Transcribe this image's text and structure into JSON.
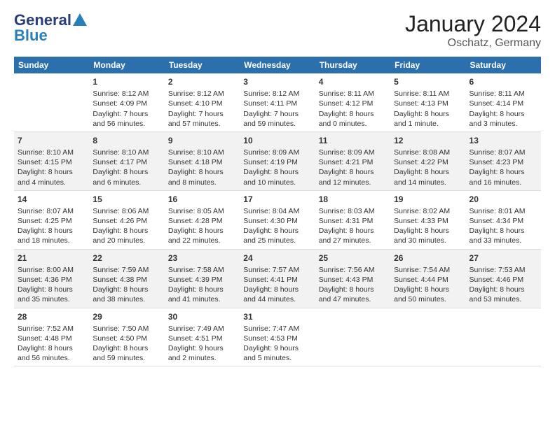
{
  "logo": {
    "general": "General",
    "blue": "Blue"
  },
  "header": {
    "title": "January 2024",
    "location": "Oschatz, Germany"
  },
  "columns": [
    "Sunday",
    "Monday",
    "Tuesday",
    "Wednesday",
    "Thursday",
    "Friday",
    "Saturday"
  ],
  "weeks": [
    [
      {
        "day": "",
        "info": ""
      },
      {
        "day": "1",
        "info": "Sunrise: 8:12 AM\nSunset: 4:09 PM\nDaylight: 7 hours\nand 56 minutes."
      },
      {
        "day": "2",
        "info": "Sunrise: 8:12 AM\nSunset: 4:10 PM\nDaylight: 7 hours\nand 57 minutes."
      },
      {
        "day": "3",
        "info": "Sunrise: 8:12 AM\nSunset: 4:11 PM\nDaylight: 7 hours\nand 59 minutes."
      },
      {
        "day": "4",
        "info": "Sunrise: 8:11 AM\nSunset: 4:12 PM\nDaylight: 8 hours\nand 0 minutes."
      },
      {
        "day": "5",
        "info": "Sunrise: 8:11 AM\nSunset: 4:13 PM\nDaylight: 8 hours\nand 1 minute."
      },
      {
        "day": "6",
        "info": "Sunrise: 8:11 AM\nSunset: 4:14 PM\nDaylight: 8 hours\nand 3 minutes."
      }
    ],
    [
      {
        "day": "7",
        "info": "Sunrise: 8:10 AM\nSunset: 4:15 PM\nDaylight: 8 hours\nand 4 minutes."
      },
      {
        "day": "8",
        "info": "Sunrise: 8:10 AM\nSunset: 4:17 PM\nDaylight: 8 hours\nand 6 minutes."
      },
      {
        "day": "9",
        "info": "Sunrise: 8:10 AM\nSunset: 4:18 PM\nDaylight: 8 hours\nand 8 minutes."
      },
      {
        "day": "10",
        "info": "Sunrise: 8:09 AM\nSunset: 4:19 PM\nDaylight: 8 hours\nand 10 minutes."
      },
      {
        "day": "11",
        "info": "Sunrise: 8:09 AM\nSunset: 4:21 PM\nDaylight: 8 hours\nand 12 minutes."
      },
      {
        "day": "12",
        "info": "Sunrise: 8:08 AM\nSunset: 4:22 PM\nDaylight: 8 hours\nand 14 minutes."
      },
      {
        "day": "13",
        "info": "Sunrise: 8:07 AM\nSunset: 4:23 PM\nDaylight: 8 hours\nand 16 minutes."
      }
    ],
    [
      {
        "day": "14",
        "info": "Sunrise: 8:07 AM\nSunset: 4:25 PM\nDaylight: 8 hours\nand 18 minutes."
      },
      {
        "day": "15",
        "info": "Sunrise: 8:06 AM\nSunset: 4:26 PM\nDaylight: 8 hours\nand 20 minutes."
      },
      {
        "day": "16",
        "info": "Sunrise: 8:05 AM\nSunset: 4:28 PM\nDaylight: 8 hours\nand 22 minutes."
      },
      {
        "day": "17",
        "info": "Sunrise: 8:04 AM\nSunset: 4:30 PM\nDaylight: 8 hours\nand 25 minutes."
      },
      {
        "day": "18",
        "info": "Sunrise: 8:03 AM\nSunset: 4:31 PM\nDaylight: 8 hours\nand 27 minutes."
      },
      {
        "day": "19",
        "info": "Sunrise: 8:02 AM\nSunset: 4:33 PM\nDaylight: 8 hours\nand 30 minutes."
      },
      {
        "day": "20",
        "info": "Sunrise: 8:01 AM\nSunset: 4:34 PM\nDaylight: 8 hours\nand 33 minutes."
      }
    ],
    [
      {
        "day": "21",
        "info": "Sunrise: 8:00 AM\nSunset: 4:36 PM\nDaylight: 8 hours\nand 35 minutes."
      },
      {
        "day": "22",
        "info": "Sunrise: 7:59 AM\nSunset: 4:38 PM\nDaylight: 8 hours\nand 38 minutes."
      },
      {
        "day": "23",
        "info": "Sunrise: 7:58 AM\nSunset: 4:39 PM\nDaylight: 8 hours\nand 41 minutes."
      },
      {
        "day": "24",
        "info": "Sunrise: 7:57 AM\nSunset: 4:41 PM\nDaylight: 8 hours\nand 44 minutes."
      },
      {
        "day": "25",
        "info": "Sunrise: 7:56 AM\nSunset: 4:43 PM\nDaylight: 8 hours\nand 47 minutes."
      },
      {
        "day": "26",
        "info": "Sunrise: 7:54 AM\nSunset: 4:44 PM\nDaylight: 8 hours\nand 50 minutes."
      },
      {
        "day": "27",
        "info": "Sunrise: 7:53 AM\nSunset: 4:46 PM\nDaylight: 8 hours\nand 53 minutes."
      }
    ],
    [
      {
        "day": "28",
        "info": "Sunrise: 7:52 AM\nSunset: 4:48 PM\nDaylight: 8 hours\nand 56 minutes."
      },
      {
        "day": "29",
        "info": "Sunrise: 7:50 AM\nSunset: 4:50 PM\nDaylight: 8 hours\nand 59 minutes."
      },
      {
        "day": "30",
        "info": "Sunrise: 7:49 AM\nSunset: 4:51 PM\nDaylight: 9 hours\nand 2 minutes."
      },
      {
        "day": "31",
        "info": "Sunrise: 7:47 AM\nSunset: 4:53 PM\nDaylight: 9 hours\nand 5 minutes."
      },
      {
        "day": "",
        "info": ""
      },
      {
        "day": "",
        "info": ""
      },
      {
        "day": "",
        "info": ""
      }
    ]
  ]
}
